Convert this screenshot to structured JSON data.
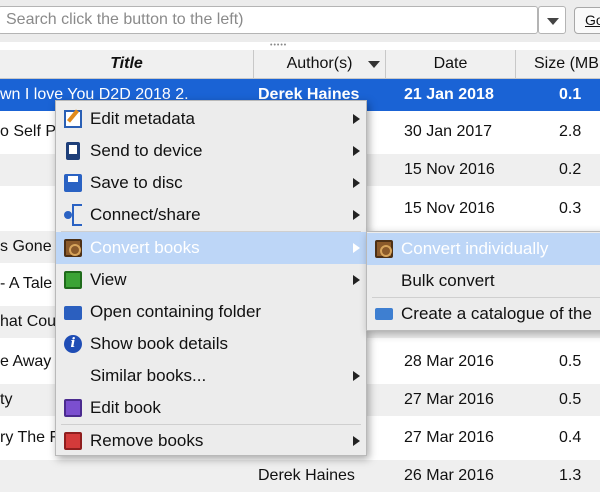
{
  "search": {
    "placeholder": "Search click the button to the left)",
    "go_label": "Go"
  },
  "columns": {
    "title": "Title",
    "author": "Author(s)",
    "date": "Date",
    "size": "Size (MB"
  },
  "rows": [
    {
      "title": "wn I love You D2D 2018 2.",
      "author": "Derek Haines",
      "date": "21 Jan 2018",
      "size": "0.1"
    },
    {
      "title": "o Self Pu",
      "author": "",
      "date": "30 Jan 2017",
      "size": "2.8"
    },
    {
      "title": "",
      "author": "",
      "date": "15 Nov 2016",
      "size": "0.2"
    },
    {
      "title": "",
      "author": "",
      "date": "15 Nov 2016",
      "size": "0.3"
    },
    {
      "title": "s Gone",
      "author": "",
      "date": "",
      "size": ""
    },
    {
      "title": "- A Tale",
      "author": "",
      "date": "",
      "size": ""
    },
    {
      "title": "hat Cou",
      "author": "",
      "date": "",
      "size": ""
    },
    {
      "title": "e Away",
      "author": "",
      "date": "28 Mar 2016",
      "size": "0.5"
    },
    {
      "title": "ty",
      "author": "",
      "date": "27 Mar 2016",
      "size": "0.5"
    },
    {
      "title": "ry The F",
      "author": "",
      "date": "27 Mar 2016",
      "size": "0.4"
    },
    {
      "title": "",
      "author": "Derek Haines",
      "date": "26 Mar 2016",
      "size": "1.3"
    }
  ],
  "menu": {
    "items": [
      {
        "label": "Edit metadata",
        "icon": "edit-metadata-icon"
      },
      {
        "label": "Send to device",
        "icon": "device-icon"
      },
      {
        "label": "Save to disc",
        "icon": "save-icon"
      },
      {
        "label": "Connect/share",
        "icon": "share-icon"
      },
      {
        "label": "Convert books",
        "icon": "convert-icon"
      },
      {
        "label": "View",
        "icon": "view-icon"
      },
      {
        "label": "Open containing folder",
        "icon": "folder-icon"
      },
      {
        "label": "Show book details",
        "icon": "info-icon"
      },
      {
        "label": "Similar books...",
        "icon": ""
      },
      {
        "label": "Edit book",
        "icon": "edit-book-icon"
      },
      {
        "label": "Remove books",
        "icon": "remove-icon"
      }
    ]
  },
  "submenu": {
    "items": [
      {
        "label": "Convert individually",
        "icon": "convert-icon"
      },
      {
        "label": "Bulk convert",
        "icon": ""
      },
      {
        "label": "Create a catalogue of the",
        "icon": "catalog-icon"
      }
    ]
  },
  "colors": {
    "selection": "#1a63d5",
    "menu_highlight": "#bdd6f7"
  }
}
